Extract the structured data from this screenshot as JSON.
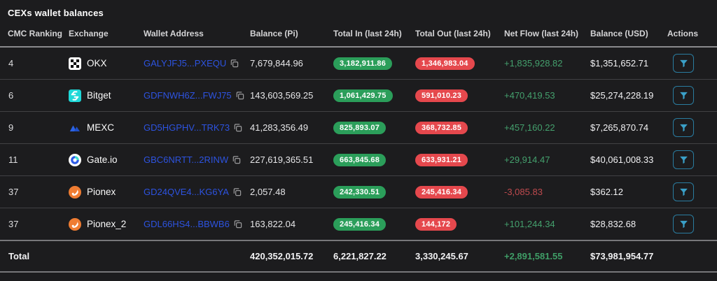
{
  "title": "CEXs wallet balances",
  "colors": {
    "badge_in": "#2b9e5a",
    "badge_out": "#e5484d",
    "flow_positive": "#44a06d",
    "flow_negative": "#bf4a4e",
    "address_link": "#2d53e0",
    "action_accent": "#3aa0c8"
  },
  "table": {
    "headers": [
      "CMC Ranking",
      "Exchange",
      "Wallet Address",
      "Balance (Pi)",
      "Total In (last 24h)",
      "Total Out (last 24h)",
      "Net Flow (last 24h)",
      "Balance (USD)",
      "Actions"
    ],
    "rows": [
      {
        "rank": "4",
        "exchange": "OKX",
        "address": "GALYJFJ5...PXEQU",
        "balance_pi": "7,679,844.96",
        "total_in": "3,182,911.86",
        "total_out": "1,346,983.04",
        "net_flow": "+1,835,928.82",
        "balance_usd": "$1,351,652.71"
      },
      {
        "rank": "6",
        "exchange": "Bitget",
        "address": "GDFNWH6Z...FWJ75",
        "balance_pi": "143,603,569.25",
        "total_in": "1,061,429.75",
        "total_out": "591,010.23",
        "net_flow": "+470,419.53",
        "balance_usd": "$25,274,228.19"
      },
      {
        "rank": "9",
        "exchange": "MEXC",
        "address": "GD5HGPHV...TRK73",
        "balance_pi": "41,283,356.49",
        "total_in": "825,893.07",
        "total_out": "368,732.85",
        "net_flow": "+457,160.22",
        "balance_usd": "$7,265,870.74"
      },
      {
        "rank": "11",
        "exchange": "Gate.io",
        "address": "GBC6NRTT...2RINW",
        "balance_pi": "227,619,365.51",
        "total_in": "663,845.68",
        "total_out": "633,931.21",
        "net_flow": "+29,914.47",
        "balance_usd": "$40,061,008.33"
      },
      {
        "rank": "37",
        "exchange": "Pionex",
        "address": "GD24QVE4...KG6YA",
        "balance_pi": "2,057.48",
        "total_in": "242,330.51",
        "total_out": "245,416.34",
        "net_flow": "-3,085.83",
        "balance_usd": "$362.12"
      },
      {
        "rank": "37",
        "exchange": "Pionex_2",
        "address": "GDL66HS4...BBWB6",
        "balance_pi": "163,822.04",
        "total_in": "245,416.34",
        "total_out": "144,172",
        "net_flow": "+101,244.34",
        "balance_usd": "$28,832.68"
      }
    ],
    "total": {
      "label": "Total",
      "balance_pi": "420,352,015.72",
      "total_in": "6,221,827.22",
      "total_out": "3,330,245.67",
      "net_flow": "+2,891,581.55",
      "balance_usd": "$73,981,954.77"
    }
  }
}
